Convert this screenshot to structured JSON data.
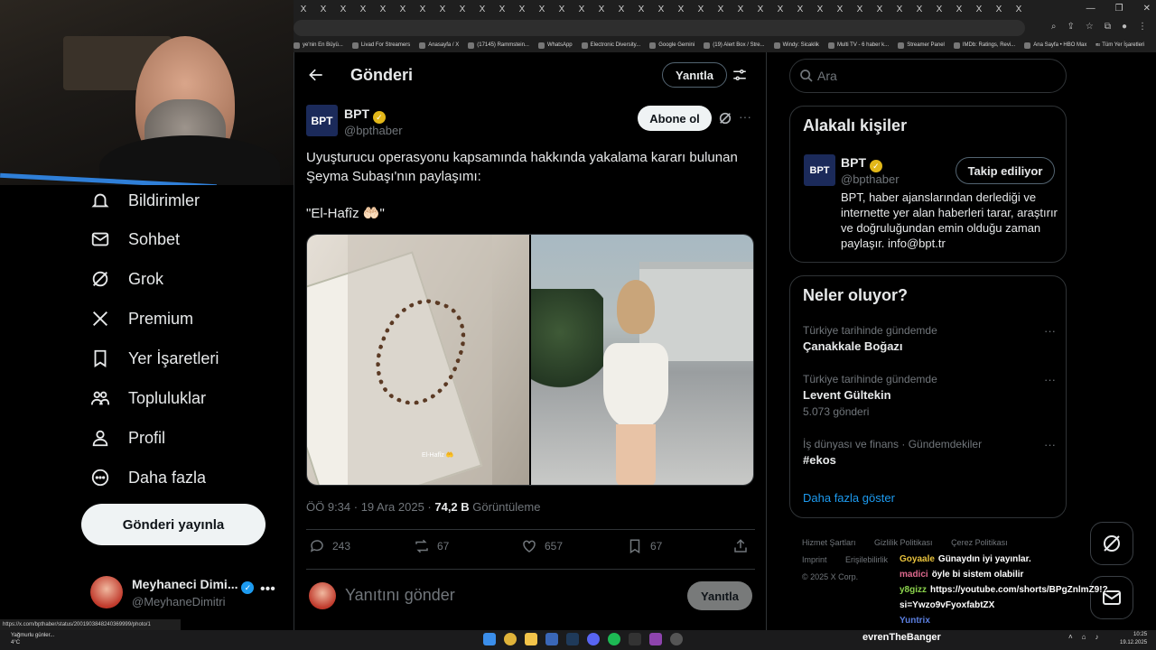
{
  "browser": {
    "tab_close_glyph": "X",
    "window_controls": [
      "—",
      "❐",
      "✕"
    ],
    "bookmarks": [
      "ye'nin En Büyü...",
      "Livad For Streamers",
      "Anasayfa / X",
      "(17145) Rammstein...",
      "WhatsApp",
      "Electronic Diversity...",
      "Google Gemini",
      "(19) Alert Box / Stre...",
      "Windy: Sicaklik",
      "Multi TV - 6 haber k...",
      "Streamer Panel",
      "IMDb: Ratings, Revi...",
      "Ana Sayfa • HBO Max"
    ],
    "bookmarks_more": "»",
    "bookmarks_all": "Tüm Yer İşaretleri"
  },
  "nav": {
    "items": [
      {
        "label": "Bildirimler",
        "icon": "bell-icon"
      },
      {
        "label": "Sohbet",
        "icon": "mail-icon"
      },
      {
        "label": "Grok",
        "icon": "grok-icon"
      },
      {
        "label": "Premium",
        "icon": "x-logo-icon"
      },
      {
        "label": "Yer İşaretleri",
        "icon": "bookmark-icon"
      },
      {
        "label": "Topluluklar",
        "icon": "communities-icon"
      },
      {
        "label": "Profil",
        "icon": "profile-icon"
      },
      {
        "label": "Daha fazla",
        "icon": "more-circle-icon"
      }
    ],
    "post_button": "Gönderi yayınla",
    "account": {
      "name": "Meyhaneci Dimi...",
      "handle": "@MeyhaneDimitri",
      "more": "•••"
    }
  },
  "main": {
    "header_title": "Gönderi",
    "reply_button": "Yanıtla",
    "author": {
      "avatar_text": "BPT",
      "name": "BPT",
      "handle": "@bpthaber"
    },
    "subscribe_button": "Abone ol",
    "more": "···",
    "text": "Uyuşturucu operasyonu kapsamında hakkında yakalama kararı bulunan Şeyma Subaşı'nın paylaşımı:",
    "quote": "\"El-Hafîz 🤲🏻\"",
    "media_caption": "El-Hafîz 🤲",
    "meta": {
      "time": "ÖÖ 9:34 · 19 Ara 2025 · ",
      "views_count": "74,2 B",
      "views_label": " Görüntüleme"
    },
    "actions": {
      "replies": "243",
      "reposts": "67",
      "likes": "657",
      "bookmarks": "67"
    },
    "reply_placeholder": "Yanıtını gönder",
    "reply_submit": "Yanıtla"
  },
  "sidebar": {
    "search_placeholder": "Ara",
    "related_title": "Alakalı kişiler",
    "related": {
      "avatar_text": "BPT",
      "name": "BPT",
      "handle": "@bpthaber",
      "button": "Takip ediliyor",
      "bio": "BPT, haber ajanslarından derlediği ve internette yer alan haberleri tarar, araştırır ve doğruluğundan emin olduğu zaman paylaşır. info@bpt.tr"
    },
    "trends_title": "Neler oluyor?",
    "trends": [
      {
        "context": "Türkiye tarihinde gündemde",
        "name": "Çanakkale Boğazı",
        "count": ""
      },
      {
        "context": "Türkiye tarihinde gündemde",
        "name": "Levent Gültekin",
        "count": "5.073 gönderi"
      },
      {
        "context": "İş dünyası ve finans · Gündemdekiler",
        "name": "#ekos",
        "count": ""
      }
    ],
    "trend_more": "···",
    "show_more": "Daha fazla göster",
    "footer": [
      "Hizmet Şartları",
      "Gizlilik Politikası",
      "Çerez Politikası",
      "Imprint",
      "Erişilebilirlik",
      "© 2025 X Corp."
    ]
  },
  "chat": [
    {
      "user": "Goyaale",
      "color": "#e8c23c",
      "msg": "Günaydın iyi yayınlar."
    },
    {
      "user": "madici",
      "color": "#e06a8f",
      "msg": "öyle bi sistem olabilir"
    },
    {
      "user": "y8gizz",
      "color": "#8bd34c",
      "msg": "https://youtube.com/shorts/BPgZnlmZ9!?si=Ywzo9vFyoxfabtZX"
    },
    {
      "user": "Yuntrix",
      "color": "#5b7fe0",
      "msg": ""
    }
  ],
  "status_url": "https://x.com/bpthaber/status/2001903848240369999/photo/1",
  "taskbar": {
    "weather": "Yağmurlu günler...",
    "temp": "4°C",
    "streamer": "evrenTheBanger",
    "time": "10:25",
    "date": "19.12.2025"
  },
  "colors": {
    "accent": "#1d9bf0",
    "verified_gold": "#e2b719",
    "border": "#2f3336",
    "muted": "#71767b"
  }
}
